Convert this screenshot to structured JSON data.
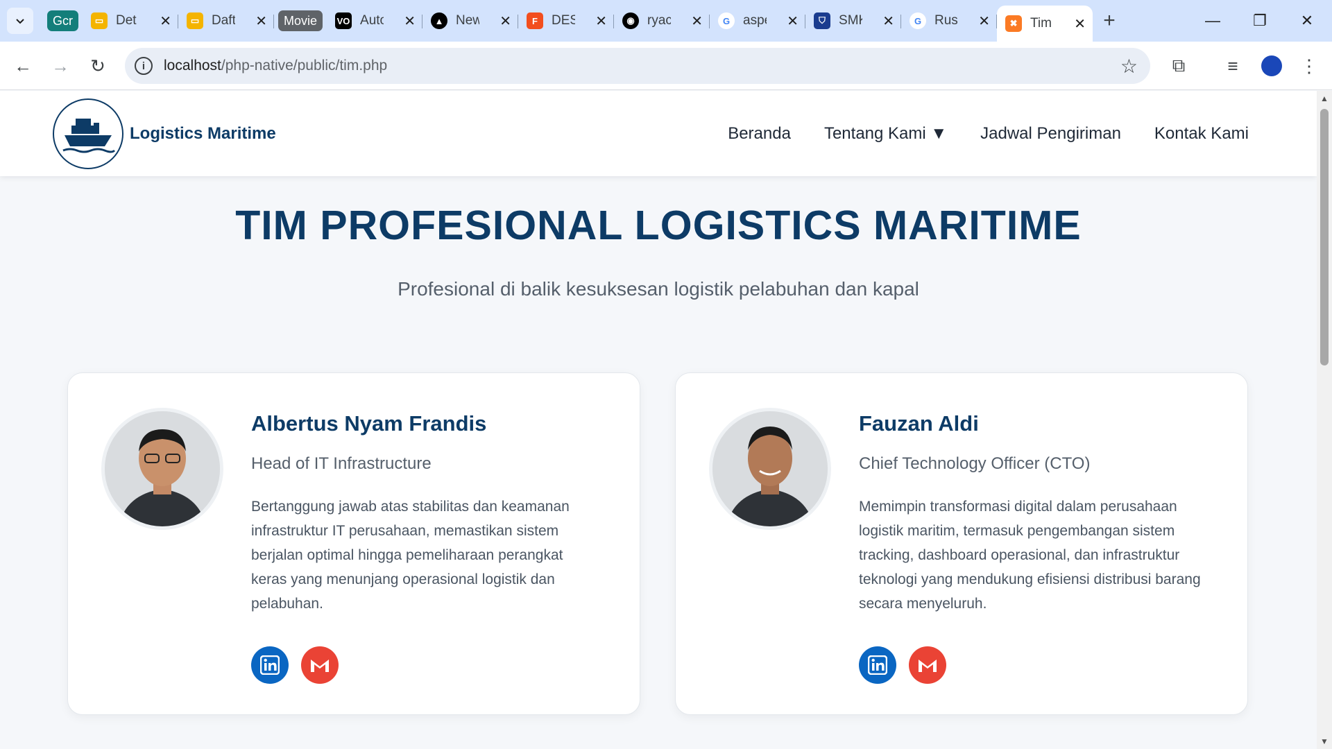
{
  "browser": {
    "tabs": [
      {
        "label": "Gcr",
        "type": "group",
        "color": "#137e7a"
      },
      {
        "label": "Det",
        "icon": "slides-icon",
        "color": "#f4b400"
      },
      {
        "label": "Daft",
        "icon": "slides-icon",
        "color": "#f4b400"
      },
      {
        "label": "Movie",
        "type": "group",
        "color": "#5f6368"
      },
      {
        "label": "Auto",
        "icon": "vo-icon",
        "color": "#000000"
      },
      {
        "label": "New",
        "icon": "triangle-icon",
        "color": "#000000"
      },
      {
        "label": "DES",
        "icon": "figma-icon",
        "color": "#f24e1e"
      },
      {
        "label": "ryac",
        "icon": "github-icon",
        "color": "#000000"
      },
      {
        "label": "aspe",
        "icon": "google-icon",
        "color": "#4285f4"
      },
      {
        "label": "SMK",
        "icon": "shield-icon",
        "color": "#1a3c8f"
      },
      {
        "label": "Rus",
        "icon": "google-icon",
        "color": "#4285f4"
      },
      {
        "label": "Tim",
        "icon": "xampp-icon",
        "color": "#fb7a24",
        "active": true
      }
    ],
    "url_host": "localhost",
    "url_path": "/php-native/public/tim.php"
  },
  "site": {
    "brand": "Logistics Maritime",
    "menu": [
      "Beranda",
      "Tentang Kami ▼",
      "Jadwal Pengiriman",
      "Kontak Kami"
    ],
    "title": "TIM PROFESIONAL LOGISTICS MARITIME",
    "subtitle": "Profesional di balik kesuksesan logistik pelabuhan dan kapal"
  },
  "team": [
    {
      "name": "Albertus Nyam Frandis",
      "role": "Head of IT Infrastructure",
      "desc": "Bertanggung jawab atas stabilitas dan keamanan infrastruktur IT perusahaan, memastikan sistem berjalan optimal hingga pemeliharaan perangkat keras yang menunjang operasional logistik dan pelabuhan."
    },
    {
      "name": "Fauzan Aldi",
      "role": "Chief Technology Officer (CTO)",
      "desc": "Memimpin transformasi digital dalam perusahaan logistik maritim, termasuk pengembangan sistem tracking, dashboard operasional, dan infrastruktur teknologi yang mendukung efisiensi distribusi barang secara menyeluruh."
    }
  ],
  "colors": {
    "primary": "#0d3b66",
    "linkedin": "#0a66c2",
    "gmail": "#ea4335"
  }
}
